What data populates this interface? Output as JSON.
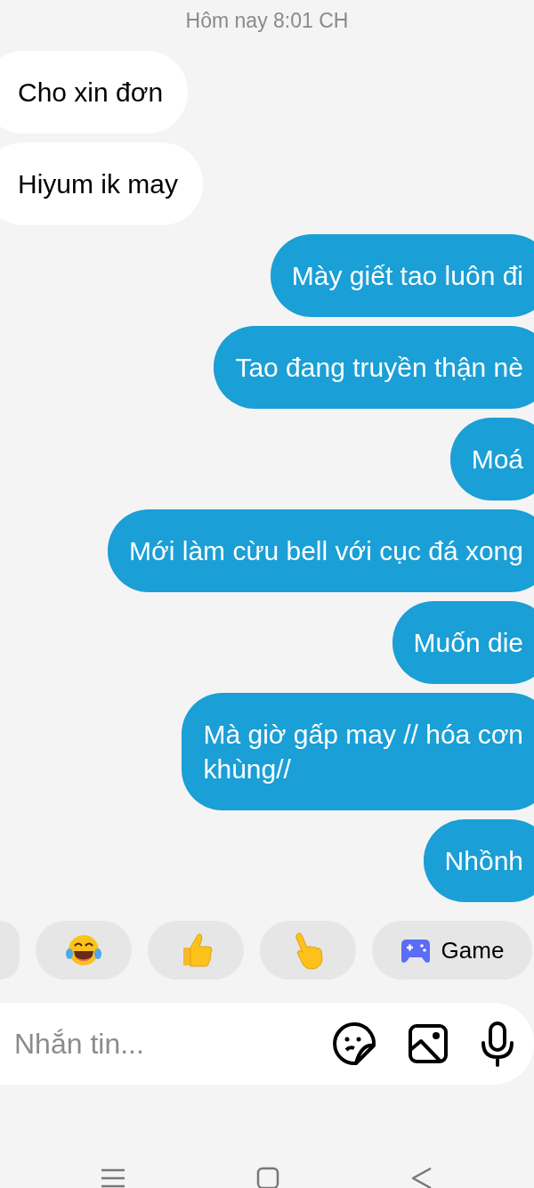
{
  "timestamp": "Hôm nay 8:01 CH",
  "messages": [
    {
      "kind": "incoming",
      "text": "Cho xin đơn"
    },
    {
      "kind": "incoming",
      "text": "Hiyum ik may"
    },
    {
      "kind": "outgoing",
      "text": "Mày giết tao luôn đi"
    },
    {
      "kind": "outgoing",
      "text": "Tao đang truyền thận nè"
    },
    {
      "kind": "outgoing",
      "text": "Moá"
    },
    {
      "kind": "outgoing",
      "text": "Mới làm cừu bell với cục đá xong"
    },
    {
      "kind": "outgoing",
      "text": "Muốn die"
    },
    {
      "kind": "outgoing",
      "text": "Mà giờ gấp may // hóa cơn\nkhùng//"
    },
    {
      "kind": "outgoing",
      "text": "Nhồnh"
    }
  ],
  "quick_replies": [
    {
      "kind": "partial"
    },
    {
      "kind": "laugh"
    },
    {
      "kind": "thumbs_up"
    },
    {
      "kind": "point"
    },
    {
      "kind": "game",
      "label": "Game"
    }
  ],
  "composer": {
    "placeholder": "Nhắn tin..."
  }
}
